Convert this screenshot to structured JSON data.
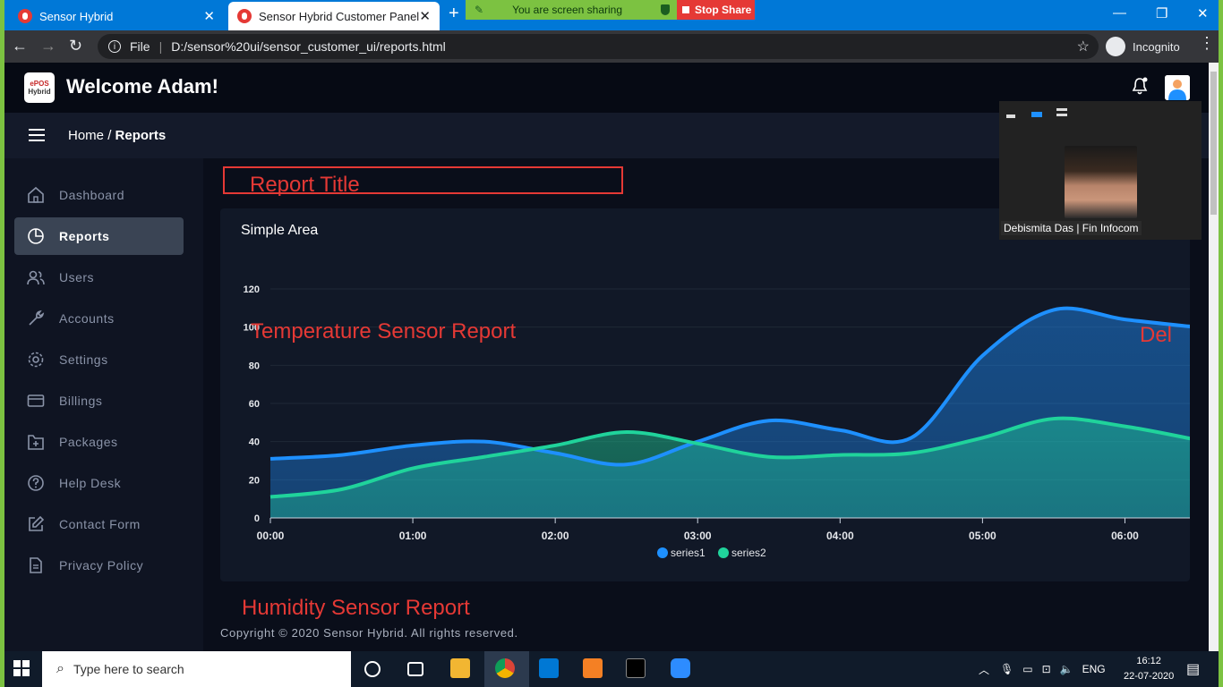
{
  "browser": {
    "tabs": [
      {
        "title": "Sensor Hybrid"
      },
      {
        "title": "Sensor Hybrid Customer Panel"
      }
    ],
    "share_banner": "You are screen sharing",
    "stop_share": "Stop Share",
    "url_scheme": "File",
    "url": "D:/sensor%20ui/sensor_customer_ui/reports.html",
    "profile": "Incognito"
  },
  "app": {
    "logo_top": "ePOS",
    "logo_bottom": "Hybrid",
    "welcome": "Welcome Adam!",
    "breadcrumb_home": "Home",
    "breadcrumb_sep": "/",
    "breadcrumb_current": "Reports"
  },
  "sidebar": {
    "items": [
      {
        "label": "Dashboard",
        "icon": "home-icon"
      },
      {
        "label": "Reports",
        "icon": "pie-chart-icon",
        "active": true
      },
      {
        "label": "Users",
        "icon": "users-icon"
      },
      {
        "label": "Accounts",
        "icon": "wrench-icon"
      },
      {
        "label": "Settings",
        "icon": "gear-icon"
      },
      {
        "label": "Billings",
        "icon": "credit-card-icon"
      },
      {
        "label": "Packages",
        "icon": "package-icon"
      },
      {
        "label": "Help Desk",
        "icon": "help-icon"
      },
      {
        "label": "Contact Form",
        "icon": "edit-icon"
      },
      {
        "label": "Privacy Policy",
        "icon": "document-icon"
      }
    ]
  },
  "report": {
    "title_box": "Report Title",
    "card_title": "Simple Area",
    "annotation_temp": "Temperature Sensor Report",
    "annotation_del": "Del",
    "annotation_humidity": "Humidity Sensor Report",
    "footer": "Copyright © 2020 Sensor Hybrid. All rights reserved."
  },
  "chart_data": {
    "type": "area",
    "title": "Simple Area",
    "x": [
      "00:00",
      "00:30",
      "01:00",
      "01:30",
      "02:00",
      "02:30",
      "03:00",
      "03:30",
      "04:00",
      "04:30",
      "05:00",
      "05:30",
      "06:00",
      "06:30"
    ],
    "xticks": [
      "00:00",
      "01:00",
      "02:00",
      "03:00",
      "04:00",
      "05:00",
      "06:00"
    ],
    "yticks": [
      0,
      20,
      40,
      60,
      80,
      100,
      120
    ],
    "ylim": [
      0,
      120
    ],
    "series": [
      {
        "name": "series1",
        "values": [
          31,
          33,
          38,
          40,
          34,
          28,
          40,
          51,
          46,
          42,
          85,
          109,
          104,
          100
        ],
        "color": "#1e90ff"
      },
      {
        "name": "series2",
        "values": [
          11,
          15,
          26,
          32,
          38,
          45,
          39,
          32,
          33,
          34,
          42,
          52,
          48,
          41
        ],
        "color": "#20d39b"
      }
    ],
    "legend": "bottom",
    "grid": true
  },
  "video": {
    "participant": "Debismita Das | Fin Infocom"
  },
  "taskbar": {
    "search_placeholder": "Type here to search",
    "lang": "ENG",
    "time": "16:12",
    "date": "22-07-2020"
  }
}
